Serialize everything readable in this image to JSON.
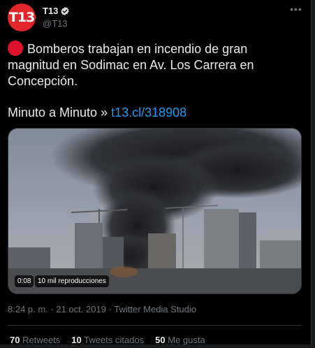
{
  "author": {
    "display_name": "T13",
    "handle": "@T13",
    "avatar_text": "T13",
    "verified": true
  },
  "tweet": {
    "text": "Bomberos trabajan en incendio de gran magnitud en Sodimac en Av. Los Carrera en Concepción.",
    "line2_prefix": "Minuto a Minuto » ",
    "link": "t13.cl/318908"
  },
  "video": {
    "duration": "0:08",
    "views": "10 mil reproducciones"
  },
  "meta": "8:24 p. m. · 21 oct. 2019 · Twitter Media Studio",
  "stats": {
    "retweets_count": "70",
    "retweets_label": "Retweets",
    "quotes_count": "10",
    "quotes_label": "Tweets citados",
    "likes_count": "50",
    "likes_label": "Me gusta"
  },
  "colors": {
    "background": "#000000",
    "accent_link": "#1d9bf0",
    "avatar": "#e3262a",
    "live_dot": "#e0112c",
    "muted": "#71767b"
  },
  "icons": [
    "verified-badge-icon",
    "more-options-icon",
    "live-dot-icon"
  ]
}
